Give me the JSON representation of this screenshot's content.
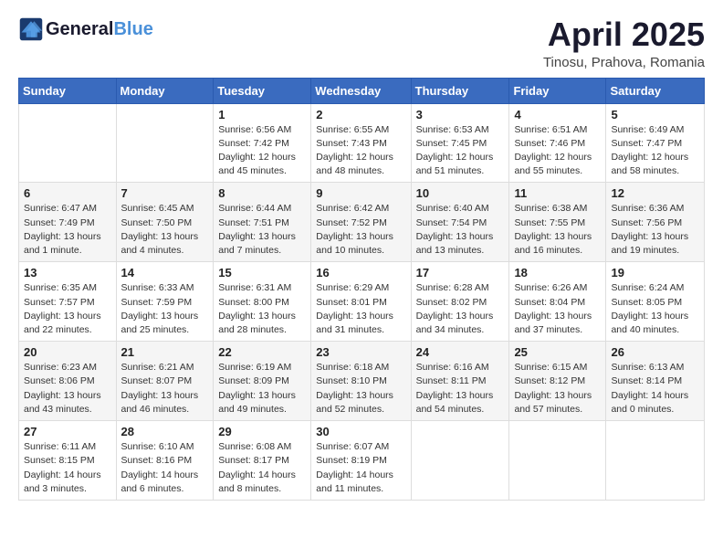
{
  "header": {
    "logo_line1": "General",
    "logo_line2": "Blue",
    "month_year": "April 2025",
    "location": "Tinosu, Prahova, Romania"
  },
  "weekdays": [
    "Sunday",
    "Monday",
    "Tuesday",
    "Wednesday",
    "Thursday",
    "Friday",
    "Saturday"
  ],
  "weeks": [
    [
      {
        "day": "",
        "info": ""
      },
      {
        "day": "",
        "info": ""
      },
      {
        "day": "1",
        "info": "Sunrise: 6:56 AM\nSunset: 7:42 PM\nDaylight: 12 hours\nand 45 minutes."
      },
      {
        "day": "2",
        "info": "Sunrise: 6:55 AM\nSunset: 7:43 PM\nDaylight: 12 hours\nand 48 minutes."
      },
      {
        "day": "3",
        "info": "Sunrise: 6:53 AM\nSunset: 7:45 PM\nDaylight: 12 hours\nand 51 minutes."
      },
      {
        "day": "4",
        "info": "Sunrise: 6:51 AM\nSunset: 7:46 PM\nDaylight: 12 hours\nand 55 minutes."
      },
      {
        "day": "5",
        "info": "Sunrise: 6:49 AM\nSunset: 7:47 PM\nDaylight: 12 hours\nand 58 minutes."
      }
    ],
    [
      {
        "day": "6",
        "info": "Sunrise: 6:47 AM\nSunset: 7:49 PM\nDaylight: 13 hours\nand 1 minute."
      },
      {
        "day": "7",
        "info": "Sunrise: 6:45 AM\nSunset: 7:50 PM\nDaylight: 13 hours\nand 4 minutes."
      },
      {
        "day": "8",
        "info": "Sunrise: 6:44 AM\nSunset: 7:51 PM\nDaylight: 13 hours\nand 7 minutes."
      },
      {
        "day": "9",
        "info": "Sunrise: 6:42 AM\nSunset: 7:52 PM\nDaylight: 13 hours\nand 10 minutes."
      },
      {
        "day": "10",
        "info": "Sunrise: 6:40 AM\nSunset: 7:54 PM\nDaylight: 13 hours\nand 13 minutes."
      },
      {
        "day": "11",
        "info": "Sunrise: 6:38 AM\nSunset: 7:55 PM\nDaylight: 13 hours\nand 16 minutes."
      },
      {
        "day": "12",
        "info": "Sunrise: 6:36 AM\nSunset: 7:56 PM\nDaylight: 13 hours\nand 19 minutes."
      }
    ],
    [
      {
        "day": "13",
        "info": "Sunrise: 6:35 AM\nSunset: 7:57 PM\nDaylight: 13 hours\nand 22 minutes."
      },
      {
        "day": "14",
        "info": "Sunrise: 6:33 AM\nSunset: 7:59 PM\nDaylight: 13 hours\nand 25 minutes."
      },
      {
        "day": "15",
        "info": "Sunrise: 6:31 AM\nSunset: 8:00 PM\nDaylight: 13 hours\nand 28 minutes."
      },
      {
        "day": "16",
        "info": "Sunrise: 6:29 AM\nSunset: 8:01 PM\nDaylight: 13 hours\nand 31 minutes."
      },
      {
        "day": "17",
        "info": "Sunrise: 6:28 AM\nSunset: 8:02 PM\nDaylight: 13 hours\nand 34 minutes."
      },
      {
        "day": "18",
        "info": "Sunrise: 6:26 AM\nSunset: 8:04 PM\nDaylight: 13 hours\nand 37 minutes."
      },
      {
        "day": "19",
        "info": "Sunrise: 6:24 AM\nSunset: 8:05 PM\nDaylight: 13 hours\nand 40 minutes."
      }
    ],
    [
      {
        "day": "20",
        "info": "Sunrise: 6:23 AM\nSunset: 8:06 PM\nDaylight: 13 hours\nand 43 minutes."
      },
      {
        "day": "21",
        "info": "Sunrise: 6:21 AM\nSunset: 8:07 PM\nDaylight: 13 hours\nand 46 minutes."
      },
      {
        "day": "22",
        "info": "Sunrise: 6:19 AM\nSunset: 8:09 PM\nDaylight: 13 hours\nand 49 minutes."
      },
      {
        "day": "23",
        "info": "Sunrise: 6:18 AM\nSunset: 8:10 PM\nDaylight: 13 hours\nand 52 minutes."
      },
      {
        "day": "24",
        "info": "Sunrise: 6:16 AM\nSunset: 8:11 PM\nDaylight: 13 hours\nand 54 minutes."
      },
      {
        "day": "25",
        "info": "Sunrise: 6:15 AM\nSunset: 8:12 PM\nDaylight: 13 hours\nand 57 minutes."
      },
      {
        "day": "26",
        "info": "Sunrise: 6:13 AM\nSunset: 8:14 PM\nDaylight: 14 hours\nand 0 minutes."
      }
    ],
    [
      {
        "day": "27",
        "info": "Sunrise: 6:11 AM\nSunset: 8:15 PM\nDaylight: 14 hours\nand 3 minutes."
      },
      {
        "day": "28",
        "info": "Sunrise: 6:10 AM\nSunset: 8:16 PM\nDaylight: 14 hours\nand 6 minutes."
      },
      {
        "day": "29",
        "info": "Sunrise: 6:08 AM\nSunset: 8:17 PM\nDaylight: 14 hours\nand 8 minutes."
      },
      {
        "day": "30",
        "info": "Sunrise: 6:07 AM\nSunset: 8:19 PM\nDaylight: 14 hours\nand 11 minutes."
      },
      {
        "day": "",
        "info": ""
      },
      {
        "day": "",
        "info": ""
      },
      {
        "day": "",
        "info": ""
      }
    ]
  ]
}
